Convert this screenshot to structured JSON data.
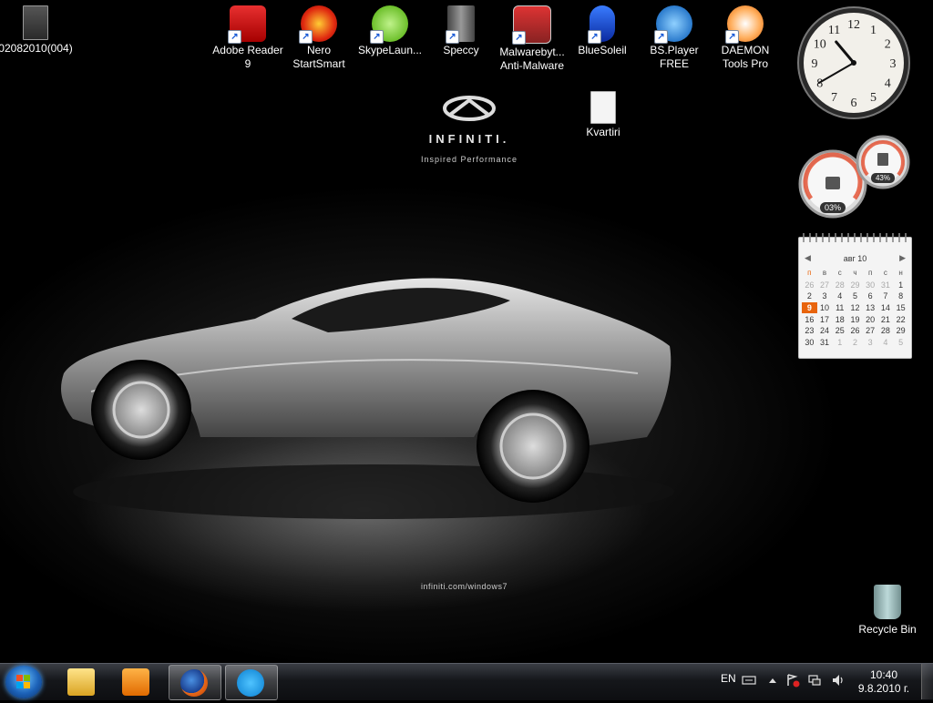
{
  "desktop": {
    "icons": [
      {
        "name": "photo-file-icon",
        "label": "02082010(004)"
      },
      {
        "name": "adobe-reader-icon",
        "label": "Adobe Reader 9"
      },
      {
        "name": "nero-startsmart-icon",
        "label": "Nero StartSmart"
      },
      {
        "name": "skypelauncher-icon",
        "label": "SkypeLaun..."
      },
      {
        "name": "speccy-icon",
        "label": "Speccy"
      },
      {
        "name": "malwarebytes-icon",
        "label": "Malwarebyt... Anti-Malware"
      },
      {
        "name": "bluesoleil-icon",
        "label": "BlueSoleil"
      },
      {
        "name": "bsplayer-icon",
        "label": "BS.Player FREE"
      },
      {
        "name": "daemon-tools-icon",
        "label": "DAEMON Tools Pro"
      },
      {
        "name": "text-file-icon",
        "label": "Kvartiri"
      }
    ],
    "recycle_bin": "Recycle Bin"
  },
  "wallpaper": {
    "brand": "INFINITI.",
    "tagline": "Inspired Performance",
    "url": "infiniti.com/windows7"
  },
  "gadgets": {
    "clock": {
      "time": "10:40",
      "numbers": [
        "12",
        "1",
        "2",
        "3",
        "4",
        "5",
        "6",
        "7",
        "8",
        "9",
        "10",
        "11"
      ]
    },
    "cpu_meter": {
      "cpu": "03%",
      "memory": "43%"
    },
    "calendar": {
      "month": "авг 10",
      "weekdays": [
        "п",
        "в",
        "с",
        "ч",
        "п",
        "с",
        "н"
      ],
      "weeks": [
        [
          "26",
          "27",
          "28",
          "29",
          "30",
          "31",
          "1"
        ],
        [
          "2",
          "3",
          "4",
          "5",
          "6",
          "7",
          "8"
        ],
        [
          "9",
          "10",
          "11",
          "12",
          "13",
          "14",
          "15"
        ],
        [
          "16",
          "17",
          "18",
          "19",
          "20",
          "21",
          "22"
        ],
        [
          "23",
          "24",
          "25",
          "26",
          "27",
          "28",
          "29"
        ],
        [
          "30",
          "31",
          "1",
          "2",
          "3",
          "4",
          "5"
        ]
      ],
      "today": "9"
    }
  },
  "taskbar": {
    "items": [
      "windows-explorer-icon",
      "media-player-icon",
      "firefox-icon",
      "skype-icon"
    ],
    "tray": {
      "language": "EN",
      "time": "10:40",
      "date": "9.8.2010 г."
    }
  },
  "colors": {
    "accent_orange": "#e8640c",
    "taskbar": "#15171b"
  }
}
